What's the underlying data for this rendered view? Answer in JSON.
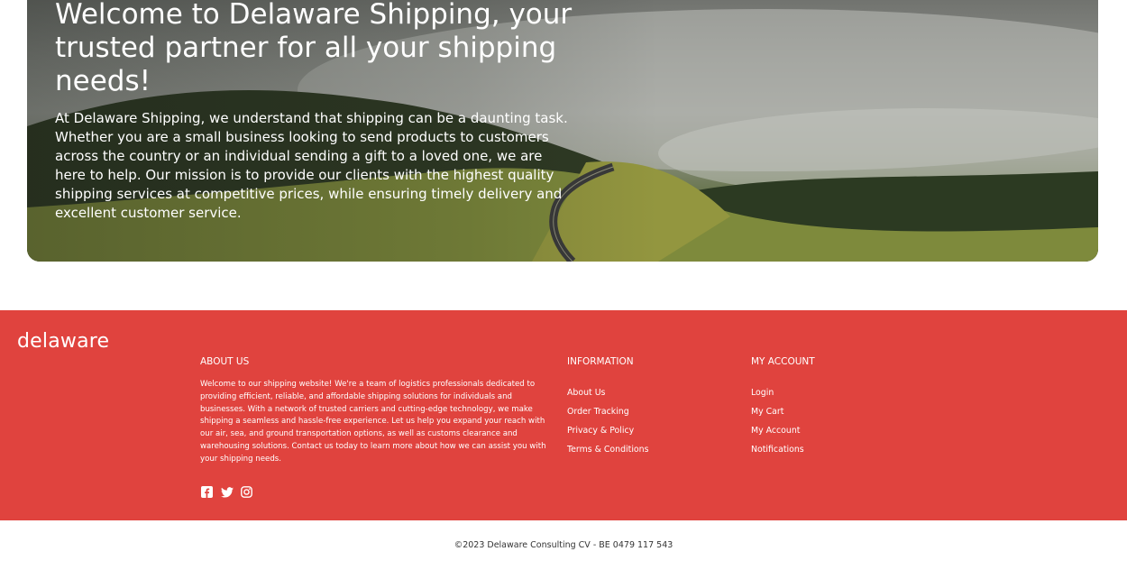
{
  "hero": {
    "title": "Welcome to Delaware Shipping, your trusted partner for all your shipping needs!",
    "text": "At Delaware Shipping, we understand that shipping can be a daunting task. Whether you are a small business looking to send products to customers across the country or an individual sending a gift to a loved one, we are here to help. Our mission is to provide our clients with the highest quality shipping services at competitive prices, while ensuring timely delivery and excellent customer service."
  },
  "footer": {
    "brand": "delaware",
    "about": {
      "title": "ABOUT US",
      "text": "Welcome to our shipping website! We're a team of logistics professionals dedicated to providing efficient, reliable, and affordable shipping solutions for individuals and businesses. With a network of trusted carriers and cutting-edge technology, we make shipping a seamless and hassle-free experience. Let us help you expand your reach with our air, sea, and ground transportation options, as well as customs clearance and warehousing solutions. Contact us today to learn more about how we can assist you with your shipping needs."
    },
    "information": {
      "title": "INFORMATION",
      "links": [
        "About Us",
        "Order Tracking",
        "Privacy & Policy",
        "Terms & Conditions"
      ]
    },
    "account": {
      "title": "MY ACCOUNT",
      "links": [
        "Login",
        "My Cart",
        "My Account",
        "Notifications"
      ]
    },
    "social_icons": [
      "facebook-icon",
      "twitter-icon",
      "instagram-icon"
    ]
  },
  "copyright": "©2023 Delaware Consulting CV - BE 0479 117 543",
  "colors": {
    "footer_bg": "#e0433e",
    "text_light": "#ffffff",
    "copyright_text": "#333333"
  }
}
